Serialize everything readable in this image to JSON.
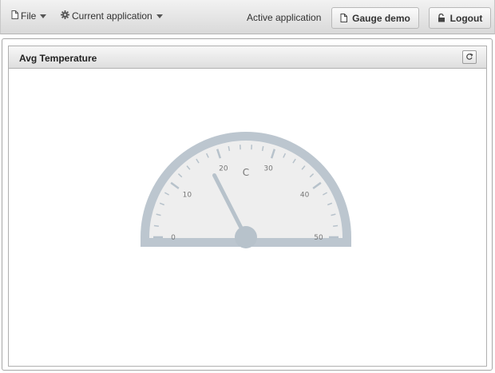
{
  "menubar": {
    "file_label": "File",
    "current_app_label": "Current application",
    "active_label": "Active application",
    "gauge_button_label": "Gauge demo",
    "logout_button_label": "Logout"
  },
  "panel": {
    "title": "Avg Temperature"
  },
  "gauge": {
    "unit": "C",
    "min": 0,
    "max": 50,
    "value": 17.5,
    "major_ticks": [
      0,
      10,
      20,
      30,
      40,
      50
    ],
    "tick_labels": [
      "0",
      "10",
      "20",
      "30",
      "40",
      "50"
    ],
    "colors": {
      "rim": "#bcc6cf",
      "face": "#eeeeee",
      "needle": "#b7c2cb",
      "tick": "#b7c2cb",
      "label": "#777777"
    }
  },
  "icons": {
    "file": "document-icon",
    "settings": "gear-icon",
    "gauge_button": "document-icon",
    "logout": "padlock-icon",
    "refresh": "refresh-icon"
  }
}
